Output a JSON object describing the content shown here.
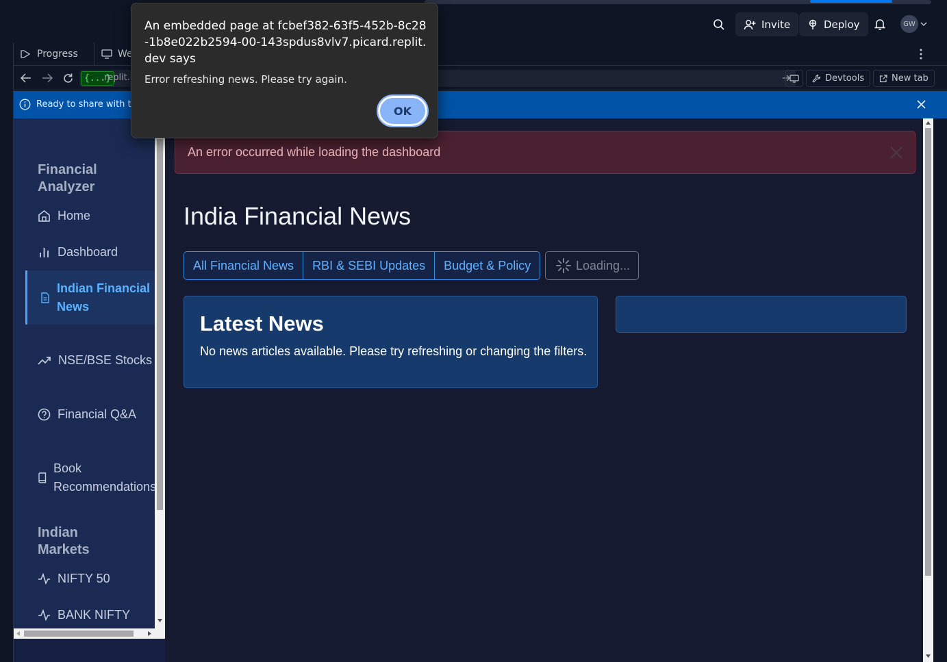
{
  "topbar": {
    "invite_label": "Invite",
    "deploy_label": "Deploy",
    "avatar_initials": "GW"
  },
  "tabs": [
    {
      "label": "Progress",
      "icon": "progress-icon"
    },
    {
      "label": "Wel",
      "icon": "monitor-icon"
    }
  ],
  "urlbar": {
    "badge": "{...}",
    "url": ".replit.",
    "devtools_label": "Devtools",
    "newtab_label": "New tab"
  },
  "banner": {
    "text": "Ready to share with the"
  },
  "sidebar": {
    "brand": "Financial Analyzer",
    "section_markets": "Indian Markets",
    "items": [
      {
        "label": "Home",
        "icon": "home-icon"
      },
      {
        "label": "Dashboard",
        "icon": "bar-chart-icon"
      },
      {
        "label": "Indian Financial News",
        "icon": "document-icon",
        "active": true
      },
      {
        "label": "NSE/BSE Stocks",
        "icon": "trend-icon"
      },
      {
        "label": "Financial Q&A",
        "icon": "question-icon"
      },
      {
        "label": "Book Recommendations",
        "icon": "book-icon"
      }
    ],
    "market_items": [
      {
        "label": "NIFTY 50",
        "icon": "pulse-icon"
      },
      {
        "label": "BANK NIFTY",
        "icon": "pulse-icon"
      }
    ]
  },
  "main": {
    "error_text": "An error occurred while loading the dashboard",
    "title": "India Financial News",
    "filters": [
      "All Financial News",
      "RBI & SEBI Updates",
      "Budget & Policy"
    ],
    "loading_label": "Loading...",
    "news_card": {
      "title": "Latest News",
      "empty_message": "No news articles available. Please try refreshing or changing the filters."
    }
  },
  "dialog": {
    "title": "An embedded page at fcbef382-63f5-452b-8c28-1b8e022b2594-00-143spdus8vlv7.picard.replit.dev says",
    "message": "Error refreshing news. Please try again.",
    "ok_label": "OK"
  },
  "colors": {
    "accent": "#0079f2",
    "banner": "#0053a6",
    "active_link": "#59b2ff",
    "error_bg": "#4a2130",
    "card_bg": "#163a6b"
  }
}
